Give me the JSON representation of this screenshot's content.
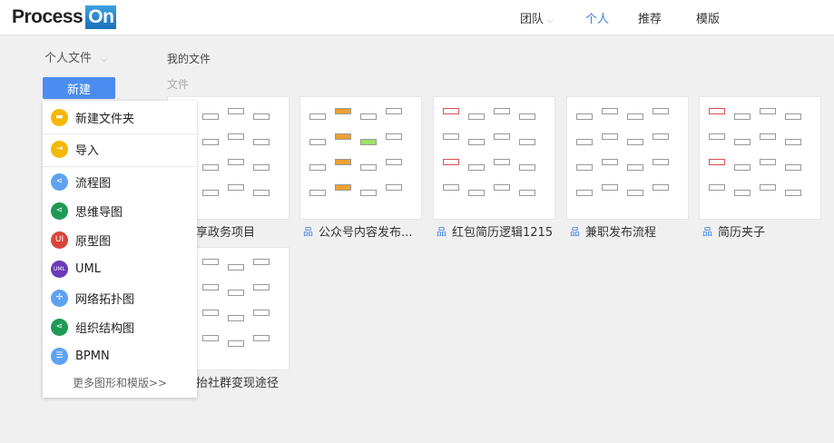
{
  "header": {
    "logo_text": "Process",
    "logo_badge": "On",
    "nav": [
      {
        "label": "团队",
        "has_dropdown": true
      },
      {
        "label": "个人",
        "active": true
      },
      {
        "label": "推荐"
      },
      {
        "label": "模版"
      }
    ]
  },
  "sidebar": {
    "title": "个人文件",
    "new_button": "新建"
  },
  "main": {
    "breadcrumb": "我的文件",
    "section": "文件",
    "files": [
      {
        "name": "享政务项目"
      },
      {
        "name": "公众号内容发布..."
      },
      {
        "name": "红包简历逻辑1215"
      },
      {
        "name": "兼职发布流程"
      },
      {
        "name": "简历夹子"
      },
      {
        "name": "抬社群变现途径"
      }
    ]
  },
  "menu": {
    "items": [
      {
        "label": "新建文件夹",
        "icon": "folder-icon",
        "color": "#f5b800"
      },
      {
        "label": "导入",
        "icon": "import-icon",
        "color": "#f5b800"
      },
      {
        "label": "流程图",
        "icon": "flowchart-icon",
        "color": "#5ea2f2"
      },
      {
        "label": "思维导图",
        "icon": "mindmap-icon",
        "color": "#1e9a55"
      },
      {
        "label": "原型图",
        "icon": "prototype-icon",
        "color": "#d9443a"
      },
      {
        "label": "UML",
        "icon": "uml-icon",
        "color": "#6a3ab8"
      },
      {
        "label": "网络拓扑图",
        "icon": "network-icon",
        "color": "#5ea2f2"
      },
      {
        "label": "组织结构图",
        "icon": "orgchart-icon",
        "color": "#1e9a55"
      },
      {
        "label": "BPMN",
        "icon": "bpmn-icon",
        "color": "#5ea2f2"
      }
    ],
    "more": "更多图形和模版>>"
  }
}
